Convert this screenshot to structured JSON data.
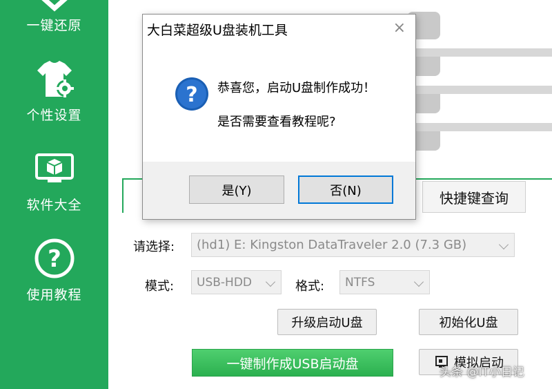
{
  "sidebar": {
    "items": [
      {
        "label": "一键还原",
        "icon": "restore-icon"
      },
      {
        "label": "个性设置",
        "icon": "shirt-gear-icon"
      },
      {
        "label": "软件大全",
        "icon": "monitor-box-icon"
      },
      {
        "label": "使用教程",
        "icon": "help-icon"
      }
    ],
    "color": "#23a85b"
  },
  "tabs": {
    "shortcut_label": "快捷键查询"
  },
  "form": {
    "select_label": "请选择:",
    "device_value": "(hd1) E: Kingston DataTraveler 2.0 (7.3 GB)",
    "mode_label": "模式:",
    "mode_value": "USB-HDD",
    "format_label": "格式:",
    "format_value": "NTFS"
  },
  "buttons": {
    "upgrade": "升级启动U盘",
    "initialize": "初始化U盘",
    "make_usb": "一键制作成USB启动盘",
    "simulate": "模拟启动"
  },
  "dialog": {
    "title": "大白菜超级U盘装机工具",
    "close": "×",
    "message1": "恭喜您，启动U盘制作成功！",
    "message2": "是否需要查看教程呢?",
    "yes": "是(Y)",
    "no": "否(N)",
    "icon": "question-icon"
  },
  "watermark": "头条 @IT小日记",
  "colors": {
    "accent": "#23a85b",
    "focus": "#0078d7",
    "question_icon": "#1a5fb4"
  }
}
